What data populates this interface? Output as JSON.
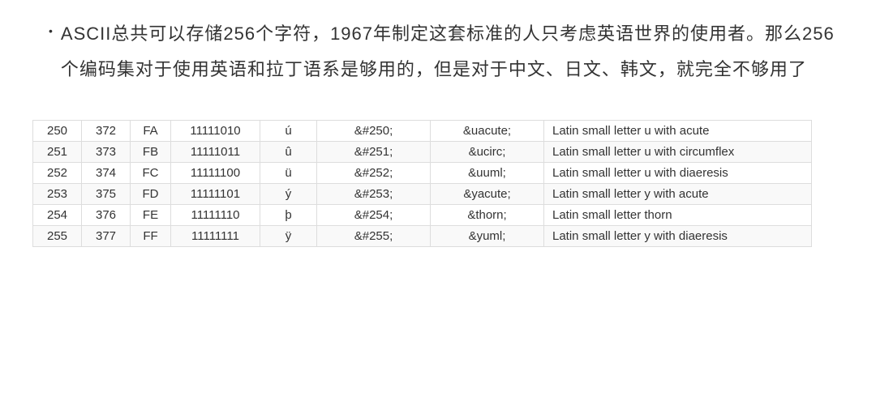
{
  "bullet": {
    "marker": "•",
    "text": "ASCII总共可以存储256个字符，1967年制定这套标准的人只考虑英语世界的使用者。那么256个编码集对于使用英语和拉丁语系是够用的，但是对于中文、日文、韩文，就完全不够用了"
  },
  "table": {
    "rows": [
      {
        "dec": "250",
        "oct": "372",
        "hex": "FA",
        "bin": "11111010",
        "char": "ú",
        "numref": "&#250;",
        "nameref": "&uacute;",
        "desc": "Latin small letter u with acute"
      },
      {
        "dec": "251",
        "oct": "373",
        "hex": "FB",
        "bin": "11111011",
        "char": "û",
        "numref": "&#251;",
        "nameref": "&ucirc;",
        "desc": "Latin small letter u with circumflex"
      },
      {
        "dec": "252",
        "oct": "374",
        "hex": "FC",
        "bin": "11111100",
        "char": "ü",
        "numref": "&#252;",
        "nameref": "&uuml;",
        "desc": "Latin small letter u with diaeresis"
      },
      {
        "dec": "253",
        "oct": "375",
        "hex": "FD",
        "bin": "11111101",
        "char": "ý",
        "numref": "&#253;",
        "nameref": "&yacute;",
        "desc": "Latin small letter y with acute"
      },
      {
        "dec": "254",
        "oct": "376",
        "hex": "FE",
        "bin": "11111110",
        "char": "þ",
        "numref": "&#254;",
        "nameref": "&thorn;",
        "desc": "Latin small letter thorn"
      },
      {
        "dec": "255",
        "oct": "377",
        "hex": "FF",
        "bin": "11111111",
        "char": "ÿ",
        "numref": "&#255;",
        "nameref": "&yuml;",
        "desc": "Latin small letter y with diaeresis"
      }
    ]
  }
}
